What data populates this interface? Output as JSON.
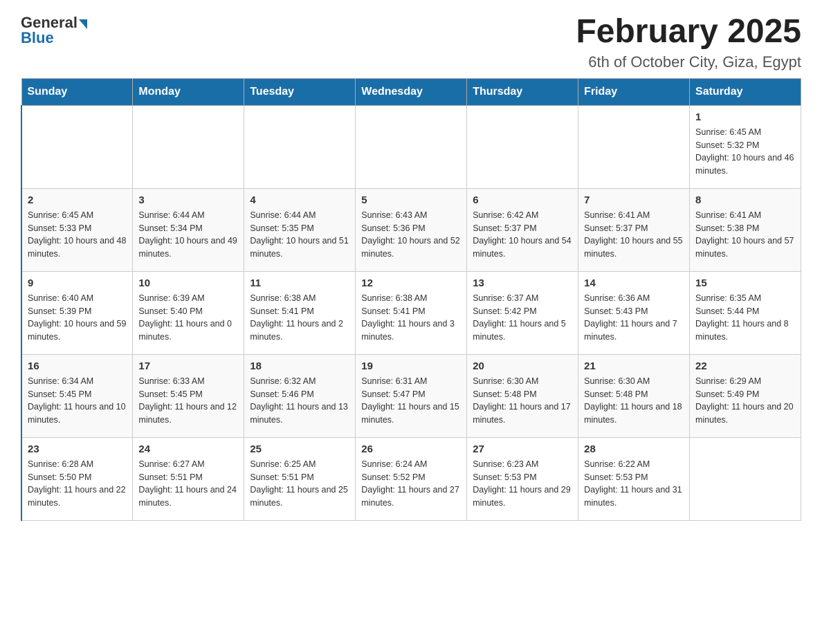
{
  "header": {
    "logo_general": "General",
    "logo_blue": "Blue",
    "main_title": "February 2025",
    "subtitle": "6th of October City, Giza, Egypt"
  },
  "calendar": {
    "days_of_week": [
      "Sunday",
      "Monday",
      "Tuesday",
      "Wednesday",
      "Thursday",
      "Friday",
      "Saturday"
    ],
    "weeks": [
      [
        {
          "day": "",
          "info": ""
        },
        {
          "day": "",
          "info": ""
        },
        {
          "day": "",
          "info": ""
        },
        {
          "day": "",
          "info": ""
        },
        {
          "day": "",
          "info": ""
        },
        {
          "day": "",
          "info": ""
        },
        {
          "day": "1",
          "info": "Sunrise: 6:45 AM\nSunset: 5:32 PM\nDaylight: 10 hours and 46 minutes."
        }
      ],
      [
        {
          "day": "2",
          "info": "Sunrise: 6:45 AM\nSunset: 5:33 PM\nDaylight: 10 hours and 48 minutes."
        },
        {
          "day": "3",
          "info": "Sunrise: 6:44 AM\nSunset: 5:34 PM\nDaylight: 10 hours and 49 minutes."
        },
        {
          "day": "4",
          "info": "Sunrise: 6:44 AM\nSunset: 5:35 PM\nDaylight: 10 hours and 51 minutes."
        },
        {
          "day": "5",
          "info": "Sunrise: 6:43 AM\nSunset: 5:36 PM\nDaylight: 10 hours and 52 minutes."
        },
        {
          "day": "6",
          "info": "Sunrise: 6:42 AM\nSunset: 5:37 PM\nDaylight: 10 hours and 54 minutes."
        },
        {
          "day": "7",
          "info": "Sunrise: 6:41 AM\nSunset: 5:37 PM\nDaylight: 10 hours and 55 minutes."
        },
        {
          "day": "8",
          "info": "Sunrise: 6:41 AM\nSunset: 5:38 PM\nDaylight: 10 hours and 57 minutes."
        }
      ],
      [
        {
          "day": "9",
          "info": "Sunrise: 6:40 AM\nSunset: 5:39 PM\nDaylight: 10 hours and 59 minutes."
        },
        {
          "day": "10",
          "info": "Sunrise: 6:39 AM\nSunset: 5:40 PM\nDaylight: 11 hours and 0 minutes."
        },
        {
          "day": "11",
          "info": "Sunrise: 6:38 AM\nSunset: 5:41 PM\nDaylight: 11 hours and 2 minutes."
        },
        {
          "day": "12",
          "info": "Sunrise: 6:38 AM\nSunset: 5:41 PM\nDaylight: 11 hours and 3 minutes."
        },
        {
          "day": "13",
          "info": "Sunrise: 6:37 AM\nSunset: 5:42 PM\nDaylight: 11 hours and 5 minutes."
        },
        {
          "day": "14",
          "info": "Sunrise: 6:36 AM\nSunset: 5:43 PM\nDaylight: 11 hours and 7 minutes."
        },
        {
          "day": "15",
          "info": "Sunrise: 6:35 AM\nSunset: 5:44 PM\nDaylight: 11 hours and 8 minutes."
        }
      ],
      [
        {
          "day": "16",
          "info": "Sunrise: 6:34 AM\nSunset: 5:45 PM\nDaylight: 11 hours and 10 minutes."
        },
        {
          "day": "17",
          "info": "Sunrise: 6:33 AM\nSunset: 5:45 PM\nDaylight: 11 hours and 12 minutes."
        },
        {
          "day": "18",
          "info": "Sunrise: 6:32 AM\nSunset: 5:46 PM\nDaylight: 11 hours and 13 minutes."
        },
        {
          "day": "19",
          "info": "Sunrise: 6:31 AM\nSunset: 5:47 PM\nDaylight: 11 hours and 15 minutes."
        },
        {
          "day": "20",
          "info": "Sunrise: 6:30 AM\nSunset: 5:48 PM\nDaylight: 11 hours and 17 minutes."
        },
        {
          "day": "21",
          "info": "Sunrise: 6:30 AM\nSunset: 5:48 PM\nDaylight: 11 hours and 18 minutes."
        },
        {
          "day": "22",
          "info": "Sunrise: 6:29 AM\nSunset: 5:49 PM\nDaylight: 11 hours and 20 minutes."
        }
      ],
      [
        {
          "day": "23",
          "info": "Sunrise: 6:28 AM\nSunset: 5:50 PM\nDaylight: 11 hours and 22 minutes."
        },
        {
          "day": "24",
          "info": "Sunrise: 6:27 AM\nSunset: 5:51 PM\nDaylight: 11 hours and 24 minutes."
        },
        {
          "day": "25",
          "info": "Sunrise: 6:25 AM\nSunset: 5:51 PM\nDaylight: 11 hours and 25 minutes."
        },
        {
          "day": "26",
          "info": "Sunrise: 6:24 AM\nSunset: 5:52 PM\nDaylight: 11 hours and 27 minutes."
        },
        {
          "day": "27",
          "info": "Sunrise: 6:23 AM\nSunset: 5:53 PM\nDaylight: 11 hours and 29 minutes."
        },
        {
          "day": "28",
          "info": "Sunrise: 6:22 AM\nSunset: 5:53 PM\nDaylight: 11 hours and 31 minutes."
        },
        {
          "day": "",
          "info": ""
        }
      ]
    ]
  }
}
